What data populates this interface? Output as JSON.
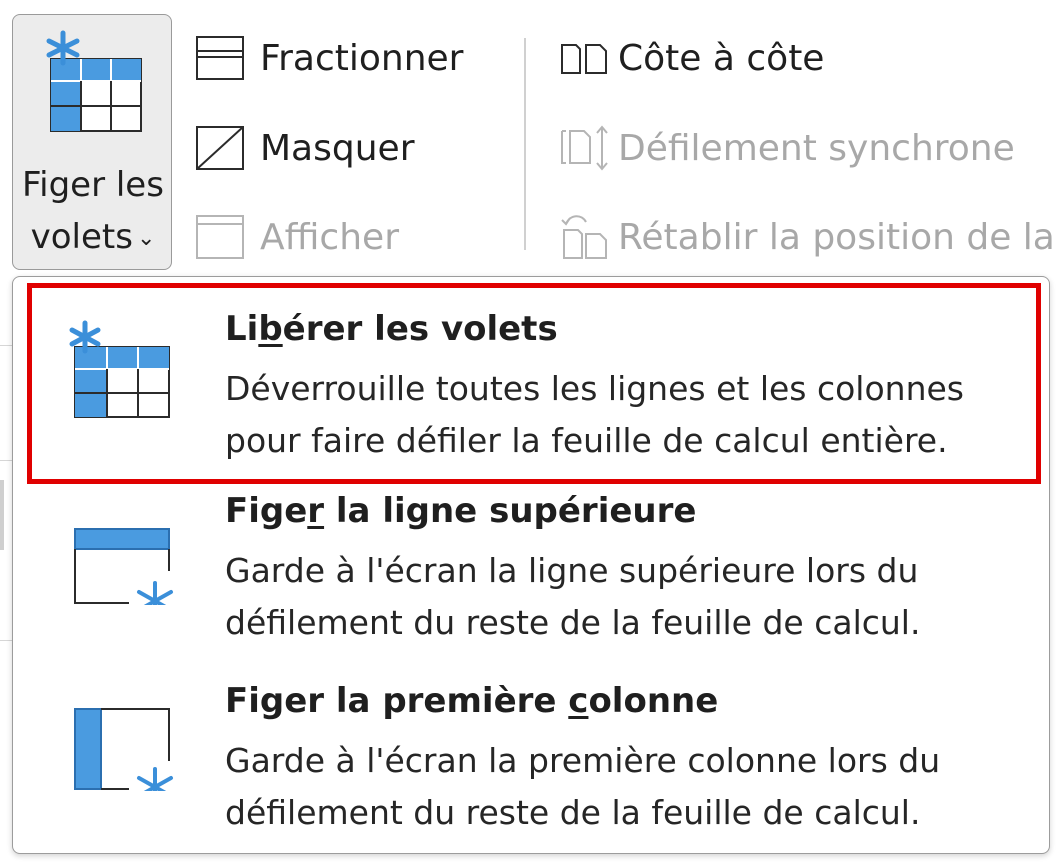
{
  "ribbon": {
    "freeze_button": {
      "line1": "Figer les",
      "line2": "volets",
      "chevron": "⌄",
      "icon": "freeze-panes-icon"
    },
    "window_group": [
      {
        "label": "Fractionner",
        "icon": "split-icon",
        "enabled": true
      },
      {
        "label": "Masquer",
        "icon": "hide-icon",
        "enabled": true
      },
      {
        "label": "Afficher",
        "icon": "unhide-icon",
        "enabled": false
      }
    ],
    "compare_group": [
      {
        "label": "Côte à côte",
        "icon": "side-by-side-icon",
        "enabled": true
      },
      {
        "label": "Défilement synchrone",
        "icon": "sync-scroll-icon",
        "enabled": false
      },
      {
        "label": "Rétablir la position de la",
        "icon": "reset-position-icon",
        "enabled": false
      }
    ]
  },
  "menu": {
    "items": [
      {
        "title_pre": "Li",
        "title_key": "b",
        "title_post": "érer les volets",
        "desc1": "Déverrouille toutes les lignes et les colonnes",
        "desc2": "pour faire défiler la feuille de calcul entière.",
        "icon": "unfreeze-panes-icon",
        "highlighted": true
      },
      {
        "title_pre": "Fige",
        "title_key": "r",
        "title_post": " la ligne supérieure",
        "desc1": "Garde à l'écran la ligne supérieure lors du",
        "desc2": "défilement du reste de la feuille de calcul.",
        "icon": "freeze-top-row-icon",
        "highlighted": false
      },
      {
        "title_pre": "Figer la première ",
        "title_key": "c",
        "title_post": "olonne",
        "desc1": "Garde à l'écran la première colonne lors du",
        "desc2": "défilement du reste de la feuille de calcul.",
        "icon": "freeze-first-column-icon",
        "highlighted": false
      }
    ]
  },
  "colors": {
    "accent_blue": "#3b8fd9",
    "highlight_red": "#e00000",
    "disabled_text": "#a8a8a8"
  }
}
